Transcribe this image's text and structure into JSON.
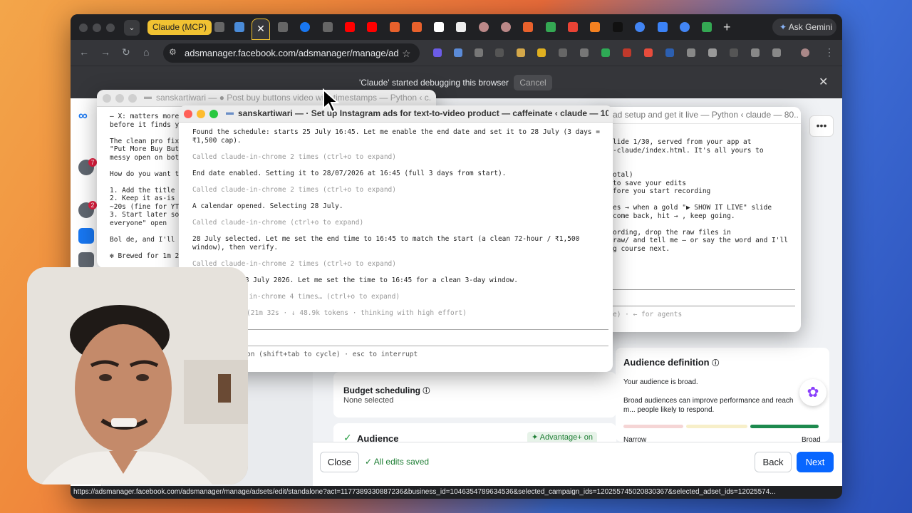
{
  "browser": {
    "tab_group_label": "Claude (MCP)",
    "active_tab_close": "✕",
    "new_tab": "+",
    "gemini_label": "Ask Gemini",
    "url": "adsmanager.facebook.com/adsmanager/manage/ad...",
    "debug_message": "'Claude' started debugging this browser",
    "debug_cancel": "Cancel",
    "status_url": "https://adsmanager.facebook.com/adsmanager/manage/adsets/edit/standalone?act=1177389330887236&business_id=1046354789634536&selected_campaign_ids=120255745020830367&selected_adset_ids=12025574..."
  },
  "fb": {
    "rail_badges": [
      "7",
      "2"
    ],
    "budget_title": "Budget scheduling",
    "budget_value": "None selected",
    "audience_title": "Audience",
    "advantage_badge": "Advantage+ on",
    "audience_definition_title": "Audience definition",
    "audience_broad": "Your audience is broad.",
    "audience_hint": "Broad audiences can improve performance and reach m... people likely to respond.",
    "meter_low": "Narrow",
    "meter_high": "Broad",
    "close_button": "Close",
    "saved_status": "All edits saved",
    "back_button": "Back",
    "next_button": "Next"
  },
  "term_back": {
    "title": "sanskartiwari — ● Post buy buttons video with timestamps — Python ‹ c...",
    "lines": [
      "– X: matters more",
      "before it finds y",
      "",
      "The clean pro fix",
      "\"Put More Buy Butt",
      "messy open on bot",
      "",
      "How do you want t",
      "",
      "1. Add the title",
      "2. Keep it as-is",
      "~20s (fine for YT",
      "3. Start later so",
      "everyone\" open",
      "",
      "Bol de, and I'll",
      "",
      "✻ Brewed for 1m 28s"
    ]
  },
  "term_right": {
    "title": "ad setup and get it live — Python ‹ claude — 80...",
    "lines": [
      "lide 1/30, served from your app at",
      "-claude/index.html. It's all yours to",
      "",
      "",
      "otal)",
      "to save your edits",
      "fore you start recording",
      "",
      "es → when a gold \"▶ SHOW IT LIVE\" slide",
      "come back, hit → , keep going.",
      "",
      "ording, drop the raw files in",
      "raw/ and tell me — or say the word and I'll",
      "g course next."
    ],
    "footer": "e) · ← for agents"
  },
  "term_main": {
    "title": "sanskartiwari — · Set up Instagram ads for text-to-video product — caffeinate ‹ claude — 103×29",
    "line1": "Found the schedule: starts 25 July 16:45. Let me enable the end date and set it to 28 July (3 days =",
    "line1b": "₹1,500 cap).",
    "called1": "Called claude-in-chrome 2 times (ctrl+o to expand)",
    "line2": "End date enabled. Setting it to 28/07/2026 at 16:45 (full 3 days from start).",
    "called2": "Called claude-in-chrome 2 times (ctrl+o to expand)",
    "line3": "A calendar opened. Selecting 28 July.",
    "called3": "Called claude-in-chrome (ctrl+o to expand)",
    "line4": "28 July selected. Let me set the end time to 16:45 to match the start (a clean 72-hour / ₹1,500",
    "line4b": "window), then verify.",
    "called4": "Called claude-in-chrome 2 times (ctrl+o to expand)",
    "line5": "28 July 2026. Let me set the time to 16:45 for a clean 3-day window.",
    "called5": "e-in-chrome 4 times… (ctrl+o to expand)",
    "status": "(21m 32s · ↓ 48.9k tokens · thinking with high effort)",
    "hint": "on (shift+tab to cycle) · esc to interrupt"
  }
}
